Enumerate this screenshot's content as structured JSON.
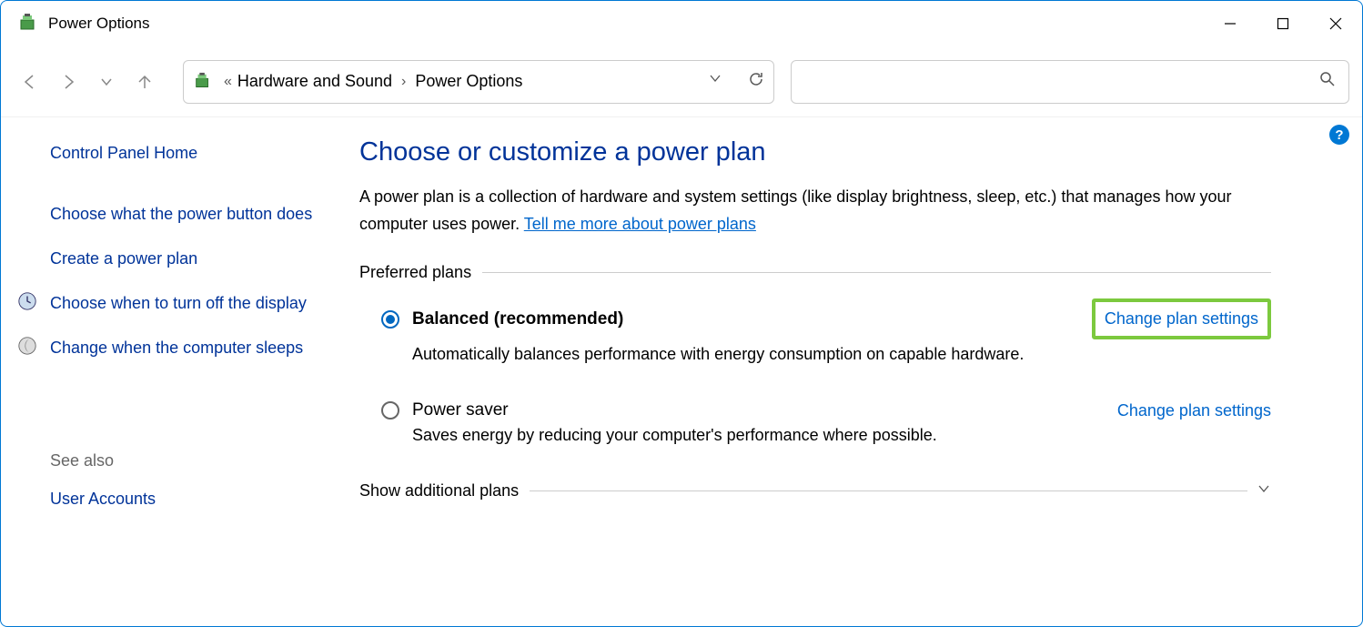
{
  "window": {
    "title": "Power Options"
  },
  "breadcrumb": {
    "seg1": "Hardware and Sound",
    "seg2": "Power Options"
  },
  "sidebar": {
    "home": "Control Panel Home",
    "items": [
      {
        "label": "Choose what the power button does",
        "icon": null
      },
      {
        "label": "Create a power plan",
        "icon": null
      },
      {
        "label": "Choose when to turn off the display",
        "icon": "clock"
      },
      {
        "label": "Change when the computer sleeps",
        "icon": "moon"
      }
    ],
    "see_also_label": "See also",
    "see_also_items": [
      {
        "label": "User Accounts"
      }
    ]
  },
  "main": {
    "title": "Choose or customize a power plan",
    "desc_a": "A power plan is a collection of hardware and system settings (like display brightness, sleep, etc.) that manages how your computer uses power. ",
    "desc_link": "Tell me more about power plans",
    "section1": "Preferred plans",
    "plans": [
      {
        "name": "Balanced (recommended)",
        "selected": true,
        "link": "Change plan settings",
        "highlight": true,
        "desc": "Automatically balances performance with energy consumption on capable hardware."
      },
      {
        "name": "Power saver",
        "selected": false,
        "link": "Change plan settings",
        "highlight": false,
        "desc": "Saves energy by reducing your computer's performance where possible."
      }
    ],
    "section2": "Show additional plans"
  },
  "help": "?"
}
